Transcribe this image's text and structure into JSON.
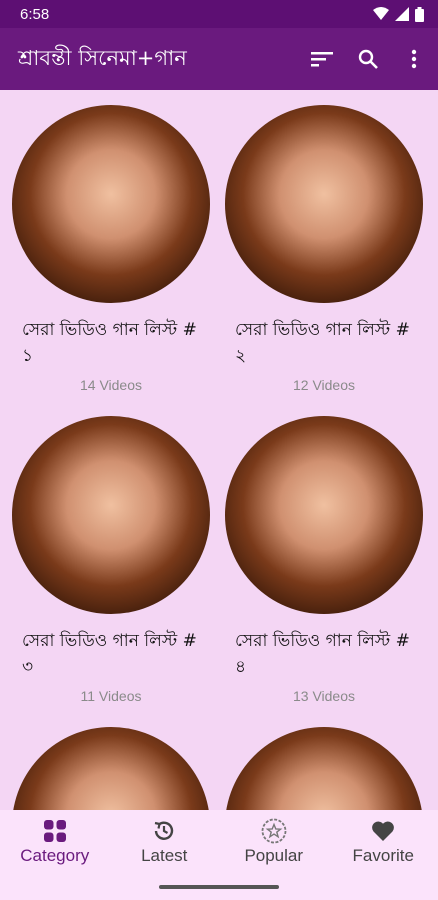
{
  "status": {
    "time": "6:58"
  },
  "appbar": {
    "title": "শ্রাবন্তী সিনেমা+গান"
  },
  "cards": [
    {
      "title": "সেরা ভিডিও গান লিস্ট # ১",
      "count": "14 Videos"
    },
    {
      "title": "সেরা ভিডিও গান লিস্ট # ২",
      "count": "12 Videos"
    },
    {
      "title": "সেরা ভিডিও গান লিস্ট # ৩",
      "count": "11 Videos"
    },
    {
      "title": "সেরা ভিডিও গান লিস্ট # ৪",
      "count": "13 Videos"
    }
  ],
  "bottom_nav": [
    {
      "label": "Category",
      "icon": "grid-icon"
    },
    {
      "label": "Latest",
      "icon": "clock-icon"
    },
    {
      "label": "Popular",
      "icon": "star-badge-icon"
    },
    {
      "label": "Favorite",
      "icon": "heart-icon"
    }
  ],
  "colors": {
    "appbar": "#6a1a7e",
    "statusbar": "#5d0f73",
    "background": "#f4d6f4",
    "nav_active": "#6a1a7e"
  }
}
